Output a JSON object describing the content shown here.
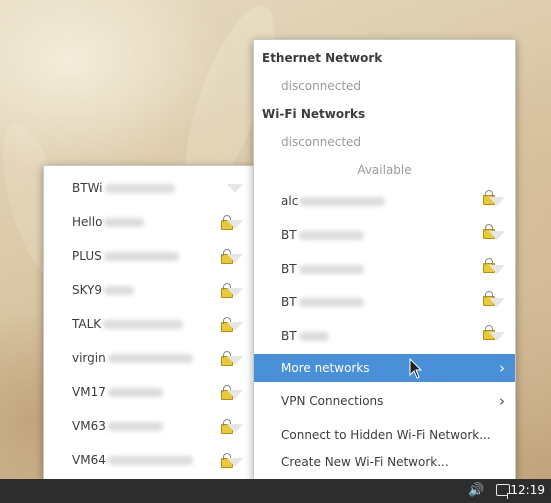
{
  "left_menu": {
    "networks": [
      {
        "ssid": "BTWi",
        "secure": false
      },
      {
        "ssid": "Hello",
        "secure": true
      },
      {
        "ssid": "PLUS",
        "secure": true
      },
      {
        "ssid": "SKY9",
        "secure": true
      },
      {
        "ssid": "TALK",
        "secure": true
      },
      {
        "ssid": "virgin",
        "secure": true
      },
      {
        "ssid": "VM17",
        "secure": true
      },
      {
        "ssid": "VM63",
        "secure": true
      },
      {
        "ssid": "VM64",
        "secure": true
      }
    ]
  },
  "right_menu": {
    "ethernet_heading": "Ethernet Network",
    "ethernet_status": "disconnected",
    "wifi_heading": "Wi-Fi Networks",
    "wifi_status": "disconnected",
    "available_label": "Available",
    "available_networks": [
      {
        "ssid": "alc",
        "secure": true
      },
      {
        "ssid": "BT",
        "secure": true
      },
      {
        "ssid": "BT",
        "secure": true
      },
      {
        "ssid": "BT",
        "secure": true
      },
      {
        "ssid": "BT",
        "secure": true
      }
    ],
    "more_networks": "More networks",
    "more_networks_arrow": "›",
    "vpn_connections": "VPN Connections",
    "vpn_arrow": "›",
    "connect_hidden": "Connect to Hidden Wi-Fi Network...",
    "create_new": "Create New Wi-Fi Network..."
  },
  "taskbar": {
    "volume_glyph": "🔊",
    "clock": "12:19"
  },
  "colors": {
    "highlight": "#4a90d9",
    "taskbar": "#2d2d2d"
  }
}
